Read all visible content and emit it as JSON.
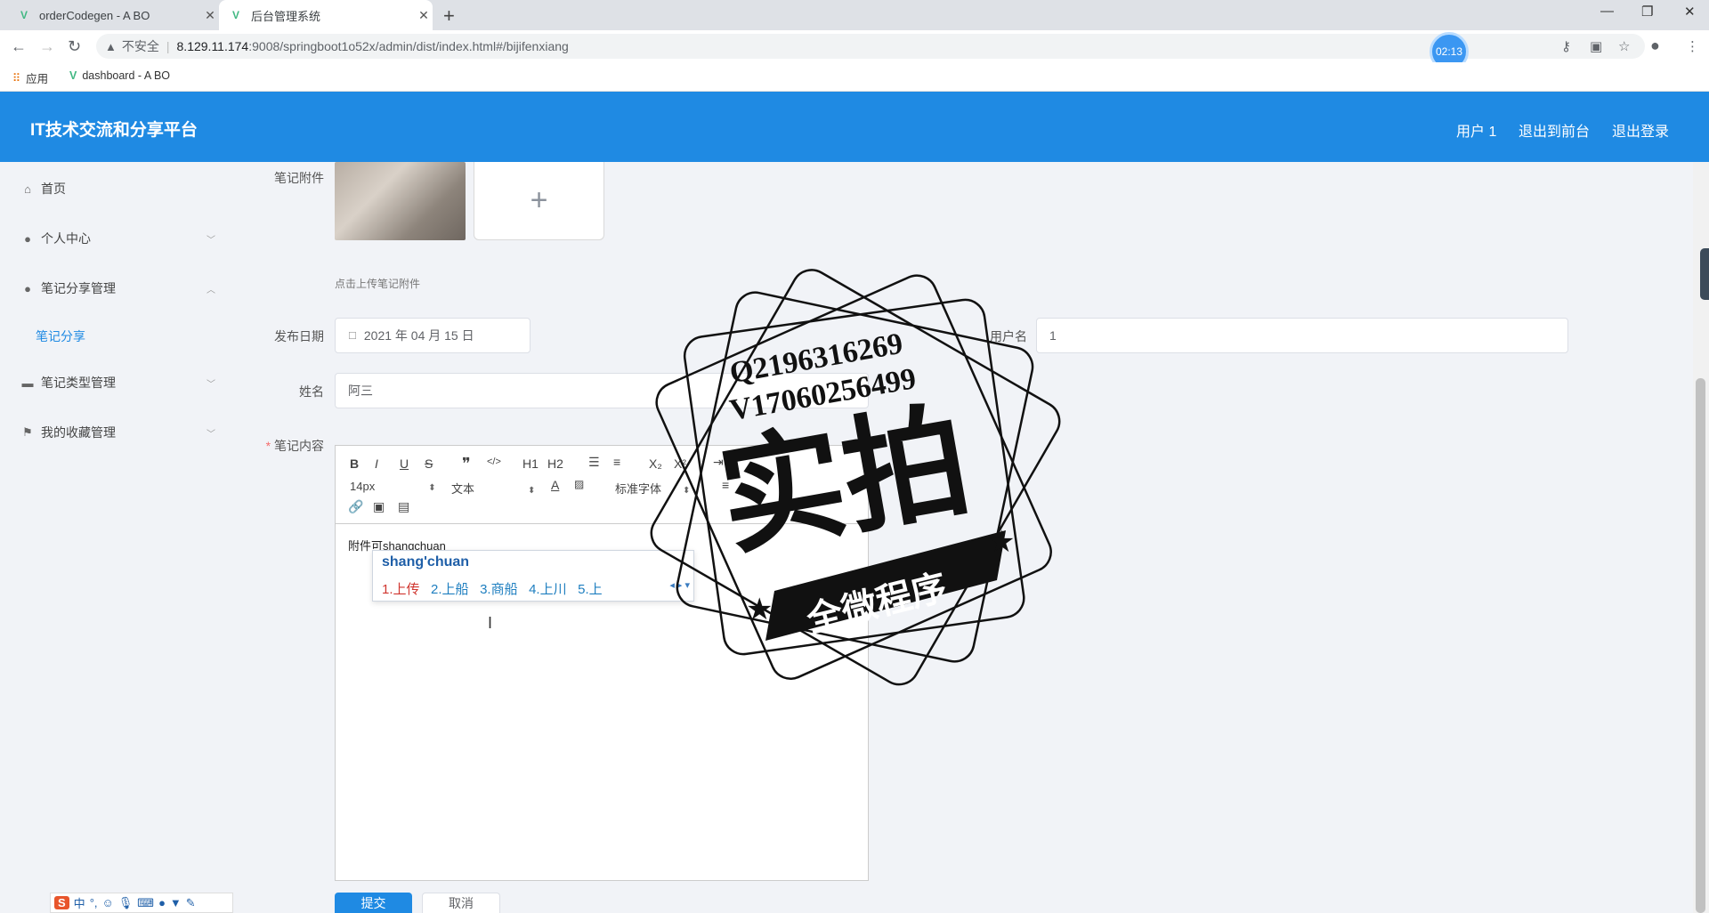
{
  "browser": {
    "tabs": [
      {
        "title": "orderCodegen - A BO",
        "active": false
      },
      {
        "title": "后台管理系统",
        "active": true
      }
    ],
    "insecure_label": "不安全",
    "url_host": "8.129.11.174",
    "url_path": ":9008/springboot1o52x/admin/dist/index.html#/bijifenxiang",
    "timer": "02:13",
    "bookmarks": [
      {
        "label": "应用",
        "icon": "apps-grid-icon"
      },
      {
        "label": "dashboard - A BO",
        "icon": "vue-logo-icon"
      }
    ]
  },
  "header": {
    "title": "IT技术交流和分享平台",
    "links": [
      "用户 1",
      "退出到前台",
      "退出登录"
    ]
  },
  "sidebar": {
    "items": [
      {
        "label": "首页",
        "icon": "home-icon",
        "expandable": false
      },
      {
        "label": "个人中心",
        "icon": "user-icon",
        "expandable": true,
        "expanded": false
      },
      {
        "label": "笔记分享管理",
        "icon": "user-icon",
        "expandable": true,
        "expanded": true
      },
      {
        "label": "笔记类型管理",
        "icon": "monitor-icon",
        "expandable": true,
        "expanded": false
      },
      {
        "label": "我的收藏管理",
        "icon": "flag-icon",
        "expandable": true,
        "expanded": false
      }
    ],
    "subitem": "笔记分享"
  },
  "form": {
    "attachment_label": "笔记附件",
    "attachment_hint": "点击上传笔记附件",
    "upload_plus": "+",
    "date_label": "发布日期",
    "date_value": "2021 年 04 月 15 日",
    "username_label": "用户名",
    "username_value": "1",
    "name_label": "姓名",
    "name_value": "阿三",
    "content_label": "笔记内容",
    "content_required_mark": "*",
    "submit": "提交",
    "cancel": "取消"
  },
  "editor": {
    "toolbar_row1": [
      "B",
      "I",
      "U",
      "S",
      "❞",
      "</>",
      "H1",
      "H2",
      "list-ordered",
      "list-bullet",
      "X₂",
      "X²",
      "indent"
    ],
    "font_size": "14px",
    "block_format": "文本",
    "font_family": "标准字体",
    "content": "附件可shangchuan"
  },
  "ime": {
    "pinyin": "shang'chuan",
    "candidates": [
      "1.上传",
      "2.上船",
      "3.商船",
      "4.上川",
      "5.上"
    ],
    "toolbar_items": [
      "S",
      "中",
      "°,",
      "☺",
      "mic",
      "keyboard",
      "user",
      "shirt",
      "wrench"
    ]
  },
  "watermark": {
    "line1": "Q2196316269",
    "line2": "V17060256499",
    "main": "实拍",
    "banner": "全微程序"
  }
}
